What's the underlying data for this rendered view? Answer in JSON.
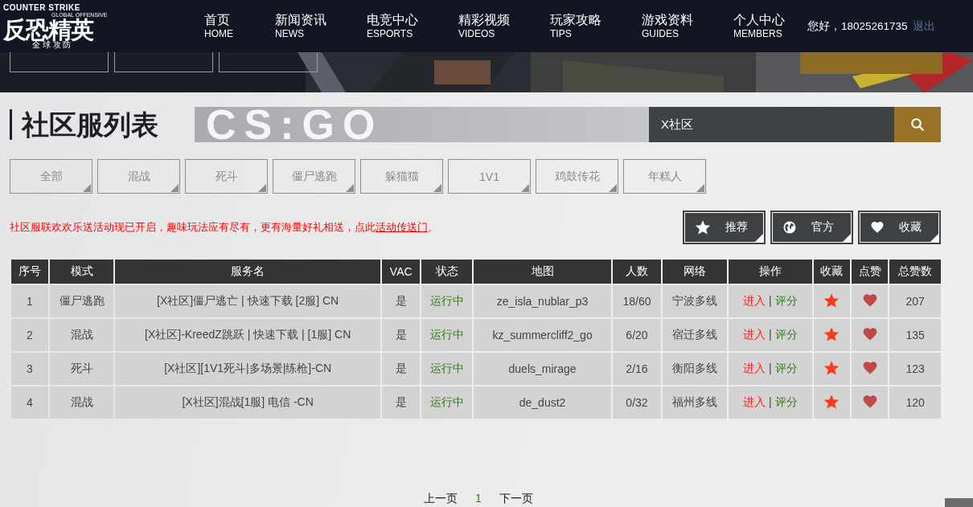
{
  "logo": {
    "brand": "COUNTER STRIKE",
    "subtitle": "GLOBAL OFFENSIVE",
    "title": "反恐精英",
    "tagline": "全 球 攻 防"
  },
  "nav": [
    {
      "label": "首页",
      "sub": "HOME"
    },
    {
      "label": "新闻资讯",
      "sub": "NEWS"
    },
    {
      "label": "电竞中心",
      "sub": "ESPORTS"
    },
    {
      "label": "精彩视频",
      "sub": "VIDEOS"
    },
    {
      "label": "玩家攻略",
      "sub": "TIPS"
    },
    {
      "label": "游戏资料",
      "sub": "GUIDES"
    },
    {
      "label": "个人中心",
      "sub": "MEMBERS"
    }
  ],
  "user": {
    "greeting": "您好，18025261735",
    "logout": "退出"
  },
  "heading": {
    "title": "社区服列表",
    "watermark": "CS:GO"
  },
  "search": {
    "value": "X社区"
  },
  "filters": [
    {
      "label": "全部",
      "selected": false
    },
    {
      "label": "混战",
      "selected": false
    },
    {
      "label": "死斗",
      "selected": false
    },
    {
      "label": "僵尸逃跑",
      "selected": false
    },
    {
      "label": "躲猫猫",
      "selected": false
    },
    {
      "label": "1V1",
      "selected": false
    },
    {
      "label": "鸡鼓传花",
      "selected": false
    },
    {
      "label": "年糕人",
      "selected": false
    }
  ],
  "notice": {
    "text": "社区服联欢欢乐送活动现已开启，趣味玩法应有尽有，更有海量好礼相送，点此",
    "link": "活动传送门",
    "end": "。"
  },
  "actions": [
    {
      "kind": "star",
      "label": "推荐"
    },
    {
      "kind": "globe",
      "label": "官方"
    },
    {
      "kind": "heart",
      "label": "收藏"
    }
  ],
  "table": {
    "columns": [
      "序号",
      "模式",
      "服务名",
      "VAC",
      "状态",
      "地图",
      "人数",
      "网络",
      "操作",
      "收藏",
      "点赞",
      "总赞数"
    ],
    "rows": [
      {
        "no": "1",
        "mode": "僵尸逃跑",
        "name": "[X社区]僵尸逃亡 | 快速下载 [2服] CN",
        "vac": "是",
        "status": "运行中",
        "map": "ze_isla_nublar_p3",
        "players": "18/60",
        "network": "宁波多线",
        "enter": "进入",
        "sep": "|",
        "rate": "评分",
        "favorited": true,
        "liked": true,
        "likes": "207"
      },
      {
        "no": "2",
        "mode": "混战",
        "name": "[X社区]-KreedZ跳跃 | 快速下载 | [1服] CN",
        "vac": "是",
        "status": "运行中",
        "map": "kz_summercliff2_go",
        "players": "6/20",
        "network": "宿迁多线",
        "enter": "进入",
        "sep": "|",
        "rate": "评分",
        "favorited": true,
        "liked": true,
        "likes": "135"
      },
      {
        "no": "3",
        "mode": "死斗",
        "name": "[X社区][1V1死斗|多场景|练枪]-CN",
        "vac": "是",
        "status": "运行中",
        "map": "duels_mirage",
        "players": "2/16",
        "network": "衡阳多线",
        "enter": "进入",
        "sep": "|",
        "rate": "评分",
        "favorited": true,
        "liked": true,
        "likes": "123"
      },
      {
        "no": "4",
        "mode": "混战",
        "name": "[X社区]混战[1服] 电信 -CN",
        "vac": "是",
        "status": "运行中",
        "map": "de_dust2",
        "players": "0/32",
        "network": "福州多线",
        "enter": "进入",
        "sep": "|",
        "rate": "评分",
        "favorited": true,
        "liked": true,
        "likes": "120"
      }
    ]
  },
  "pagination": {
    "prev": "上一页",
    "pages": [
      {
        "label": "1",
        "selected": true
      }
    ],
    "next": "下一页"
  }
}
